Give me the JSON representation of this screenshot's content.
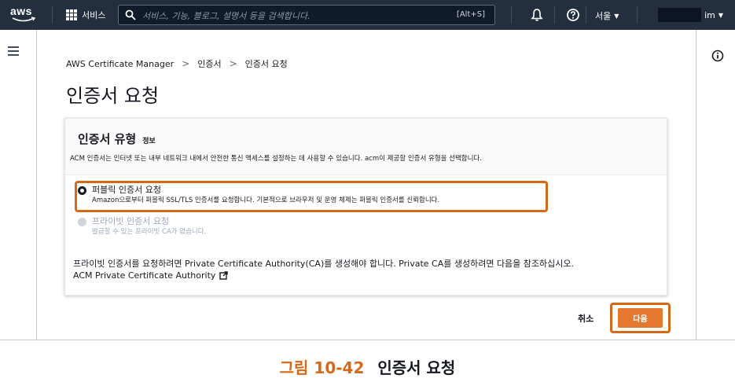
{
  "topnav": {
    "logo_text": "aws",
    "services_label": "서비스",
    "search_placeholder": "서비스, 기능, 블로그, 설명서 등을 검색합니다.",
    "search_shortcut": "[Alt+S]",
    "region_label": "서울",
    "account_suffix": "im"
  },
  "breadcrumb": {
    "items": [
      "AWS Certificate Manager",
      "인증서",
      "인증서 요청"
    ],
    "separator": ">"
  },
  "page": {
    "title": "인증서 요청"
  },
  "panel": {
    "title": "인증서 유형",
    "info_link": "정보",
    "description": "ACM 인증서는 인터넷 또는 내부 네트워크 내에서 안전한 통신 액세스를 설정하는 데 사용할 수 있습니다. acm이 제공할 인증서 유형을 선택합니다.",
    "options": [
      {
        "label": "퍼블릭 인증서 요청",
        "description": "Amazon으로부터 퍼블릭 SSL/TLS 인증서를 요청합니다. 기본적으로 브라우저 및 운영 체제는 퍼블릭 인증서를 신뢰합니다.",
        "selected": true,
        "disabled": false
      },
      {
        "label": "프라이빗 인증서 요청",
        "description": "발급할 수 있는 프라이빗 CA가 없습니다.",
        "selected": false,
        "disabled": true
      }
    ],
    "note": "프라이빗 인증서를 요청하려면 Private Certificate Authority(CA)를 생성해야 합니다. Private CA를 생성하려면 다음을 참조하십시오.",
    "link_text": "ACM Private Certificate Authority"
  },
  "actions": {
    "cancel_label": "취소",
    "next_label": "다음"
  },
  "caption": {
    "figure_number": "그림 10-42",
    "figure_title": "인증서 요청"
  },
  "colors": {
    "nav_bg": "#232f3e",
    "highlight": "#d4691a",
    "primary_button": "#e4782f"
  },
  "icons": [
    "aws-logo",
    "grid-icon",
    "search-icon",
    "bell-icon",
    "help-icon",
    "menu-icon",
    "info-icon",
    "external-link-icon"
  ]
}
